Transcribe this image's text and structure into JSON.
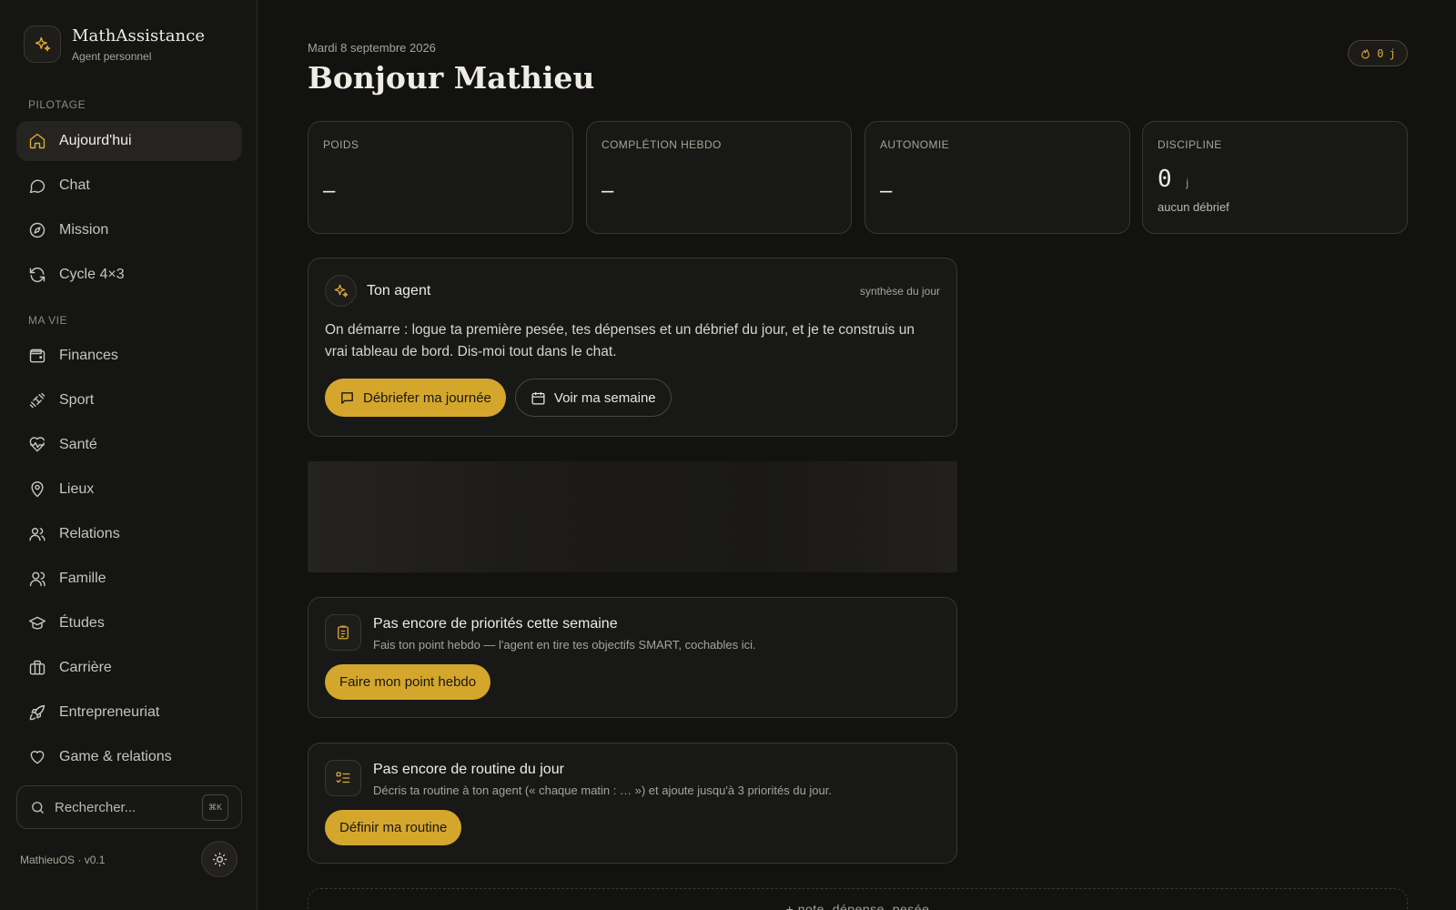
{
  "brand": {
    "name": "MathAssistance",
    "subtitle": "Agent personnel",
    "icon": "sparkles-icon"
  },
  "sidebar": {
    "sections": [
      {
        "label": "PILOTAGE",
        "items": [
          {
            "label": "Aujourd'hui",
            "icon": "home-icon",
            "active": true
          },
          {
            "label": "Chat",
            "icon": "chat-bubble-icon"
          },
          {
            "label": "Mission",
            "icon": "compass-icon"
          },
          {
            "label": "Cycle 4×3",
            "icon": "refresh-icon"
          }
        ]
      },
      {
        "label": "MA VIE",
        "items": [
          {
            "label": "Finances",
            "icon": "wallet-icon"
          },
          {
            "label": "Sport",
            "icon": "dumbbell-icon"
          },
          {
            "label": "Santé",
            "icon": "heart-pulse-icon"
          },
          {
            "label": "Lieux",
            "icon": "map-pin-icon"
          },
          {
            "label": "Relations",
            "icon": "users-icon"
          },
          {
            "label": "Famille",
            "icon": "family-icon"
          },
          {
            "label": "Études",
            "icon": "graduation-cap-icon"
          },
          {
            "label": "Carrière",
            "icon": "briefcase-icon"
          },
          {
            "label": "Entrepreneuriat",
            "icon": "rocket-icon"
          },
          {
            "label": "Game & relations",
            "icon": "heart-icon"
          }
        ]
      }
    ],
    "search": {
      "placeholder": "Rechercher...",
      "shortcut": "⌘K"
    },
    "version": "MathieuOS · v0.1",
    "theme_icon": "sun-icon"
  },
  "header": {
    "date": "Mardi 8 septembre 2026",
    "greeting": "Bonjour Mathieu",
    "streak": {
      "value": "0",
      "unit": "j",
      "icon": "flame-icon"
    }
  },
  "stats": [
    {
      "label": "POIDS",
      "value": "–"
    },
    {
      "label": "COMPLÉTION HEBDO",
      "value": "–"
    },
    {
      "label": "AUTONOMIE",
      "value": "–"
    },
    {
      "label": "DISCIPLINE",
      "value": "0",
      "unit": "j",
      "sub": "aucun débrief"
    }
  ],
  "agent": {
    "name": "Ton agent",
    "meta": "synthèse du jour",
    "message": "On démarre : logue ta première pesée, tes dépenses et un débrief du jour, et je te construis un vrai tableau de bord. Dis-moi tout dans le chat.",
    "primary_button": "Débriefer ma journée",
    "secondary_button": "Voir ma semaine"
  },
  "cards": [
    {
      "icon": "clipboard-icon",
      "title": "Pas encore de priorités cette semaine",
      "description": "Fais ton point hebdo — l'agent en tire tes objectifs SMART, cochables ici.",
      "button": "Faire mon point hebdo"
    },
    {
      "icon": "checklist-icon",
      "title": "Pas encore de routine du jour",
      "description": "Décris ta routine à ton agent (« chaque matin : … ») et ajoute jusqu'à 3 priorités du jour.",
      "button": "Définir ma routine"
    }
  ],
  "quick_add": {
    "label": "+ note, dépense, pesée"
  },
  "colors": {
    "accent": "#d4a72c",
    "background": "#121210",
    "card": "#181816",
    "border": "#3a3731"
  }
}
